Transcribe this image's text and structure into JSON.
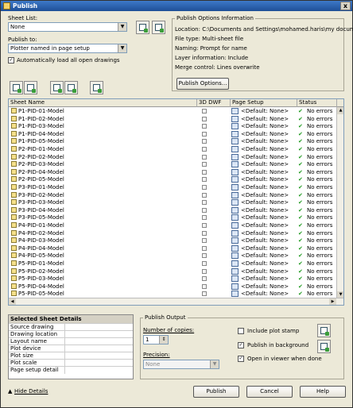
{
  "window": {
    "title": "Publish",
    "close_glyph": "x"
  },
  "sheet_list": {
    "label": "Sheet List:",
    "value": "None"
  },
  "publish_to": {
    "label": "Publish to:",
    "value": "Plotter named in page setup"
  },
  "auto_load": {
    "label": "Automatically load all open drawings",
    "checked": true
  },
  "options_info": {
    "title": "Publish Options Information",
    "location": "Location: C:\\Documents and Settings\\mohamed.haris\\my documents\\",
    "file_type": "File type: Multi-sheet file",
    "naming": "Naming: Prompt for name",
    "layer": "Layer information: Include",
    "merge": "Merge control: Lines overwrite",
    "button": "Publish Options..."
  },
  "columns": {
    "sheet_name": "Sheet Name",
    "dwf3d": "3D DWF",
    "page_setup": "Page Setup",
    "status": "Status"
  },
  "sheets": [
    {
      "name": "P1-PID-01-Model",
      "setup": "<Default: None>",
      "status": "No errors"
    },
    {
      "name": "P1-PID-02-Model",
      "setup": "<Default: None>",
      "status": "No errors"
    },
    {
      "name": "P1-PID-03-Model",
      "setup": "<Default: None>",
      "status": "No errors"
    },
    {
      "name": "P1-PID-04-Model",
      "setup": "<Default: None>",
      "status": "No errors"
    },
    {
      "name": "P1-PID-05-Model",
      "setup": "<Default: None>",
      "status": "No errors"
    },
    {
      "name": "P2-PID-01-Model",
      "setup": "<Default: None>",
      "status": "No errors"
    },
    {
      "name": "P2-PID-02-Model",
      "setup": "<Default: None>",
      "status": "No errors"
    },
    {
      "name": "P2-PID-03-Model",
      "setup": "<Default: None>",
      "status": "No errors"
    },
    {
      "name": "P2-PID-04-Model",
      "setup": "<Default: None>",
      "status": "No errors"
    },
    {
      "name": "P2-PID-05-Model",
      "setup": "<Default: None>",
      "status": "No errors"
    },
    {
      "name": "P3-PID-01-Model",
      "setup": "<Default: None>",
      "status": "No errors"
    },
    {
      "name": "P3-PID-02-Model",
      "setup": "<Default: None>",
      "status": "No errors"
    },
    {
      "name": "P3-PID-03-Model",
      "setup": "<Default: None>",
      "status": "No errors"
    },
    {
      "name": "P3-PID-04-Model",
      "setup": "<Default: None>",
      "status": "No errors"
    },
    {
      "name": "P3-PID-05-Model",
      "setup": "<Default: None>",
      "status": "No errors"
    },
    {
      "name": "P4-PID-01-Model",
      "setup": "<Default: None>",
      "status": "No errors"
    },
    {
      "name": "P4-PID-02-Model",
      "setup": "<Default: None>",
      "status": "No errors"
    },
    {
      "name": "P4-PID-03-Model",
      "setup": "<Default: None>",
      "status": "No errors"
    },
    {
      "name": "P4-PID-04-Model",
      "setup": "<Default: None>",
      "status": "No errors"
    },
    {
      "name": "P4-PID-05-Model",
      "setup": "<Default: None>",
      "status": "No errors"
    },
    {
      "name": "P5-PID-01-Model",
      "setup": "<Default: None>",
      "status": "No errors"
    },
    {
      "name": "P5-PID-02-Model",
      "setup": "<Default: None>",
      "status": "No errors"
    },
    {
      "name": "P5-PID-03-Model",
      "setup": "<Default: None>",
      "status": "No errors"
    },
    {
      "name": "P5-PID-04-Model",
      "setup": "<Default: None>",
      "status": "No errors"
    },
    {
      "name": "P5-PID-05-Model",
      "setup": "<Default: None>",
      "status": "No errors"
    }
  ],
  "status_glyph": "✔",
  "selected_details": {
    "title": "Selected Sheet Details",
    "fields": [
      "Source drawing",
      "Drawing location",
      "Layout name",
      "Plot device",
      "Plot size",
      "Plot scale",
      "Page setup detail"
    ]
  },
  "publish_output": {
    "title": "Publish Output",
    "copies_label": "Number of copies:",
    "copies_value": "1",
    "precision_label": "Precision:",
    "precision_value": "None",
    "plot_stamp": {
      "label": "Include plot stamp",
      "checked": false
    },
    "background": {
      "label": "Publish in background",
      "checked": true
    },
    "viewer": {
      "label": "Open in viewer when done",
      "checked": true
    }
  },
  "footer": {
    "hide_details": "Hide Details",
    "publish": "Publish",
    "cancel": "Cancel",
    "help": "Help"
  },
  "colors": {
    "title_bar": "#1e4f96",
    "ok_green": "#1f9a1f",
    "dialog_bg": "#ece9d8"
  }
}
